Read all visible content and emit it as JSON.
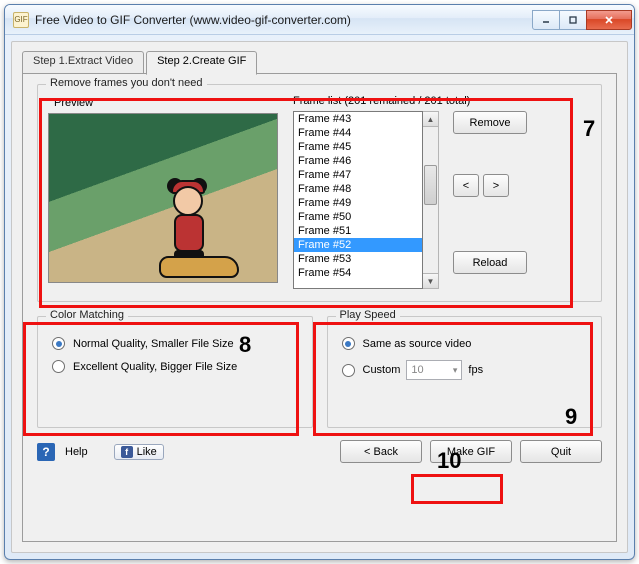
{
  "window": {
    "title": "Free Video to GIF Converter (www.video-gif-converter.com)"
  },
  "tabs": {
    "step1": "Step 1.Extract Video",
    "step2": "Step 2.Create GIF"
  },
  "frames_group": {
    "title": "Remove frames you don't need",
    "preview_label": "Preview",
    "framelist_label": "Frame list (201 remained / 201 total)",
    "items": [
      "Frame #43",
      "Frame #44",
      "Frame #45",
      "Frame #46",
      "Frame #47",
      "Frame #48",
      "Frame #49",
      "Frame #50",
      "Frame #51",
      "Frame #52",
      "Frame #53",
      "Frame #54"
    ],
    "selected_index": 9,
    "remove_btn": "Remove",
    "prev_btn": "<",
    "next_btn": ">",
    "reload_btn": "Reload"
  },
  "color_group": {
    "title": "Color Matching",
    "opt_normal": "Normal Quality, Smaller File Size",
    "opt_excellent": "Excellent Quality, Bigger File Size",
    "selected": "normal"
  },
  "speed_group": {
    "title": "Play Speed",
    "opt_same": "Same as source video",
    "opt_custom": "Custom",
    "fps_value": "10",
    "fps_unit": "fps",
    "selected": "same"
  },
  "bottom": {
    "help": "Help",
    "like": "Like",
    "back": "< Back",
    "make": "Make GIF",
    "quit": "Quit"
  },
  "annotations": {
    "n7": "7",
    "n8": "8",
    "n9": "9",
    "n10": "10"
  }
}
